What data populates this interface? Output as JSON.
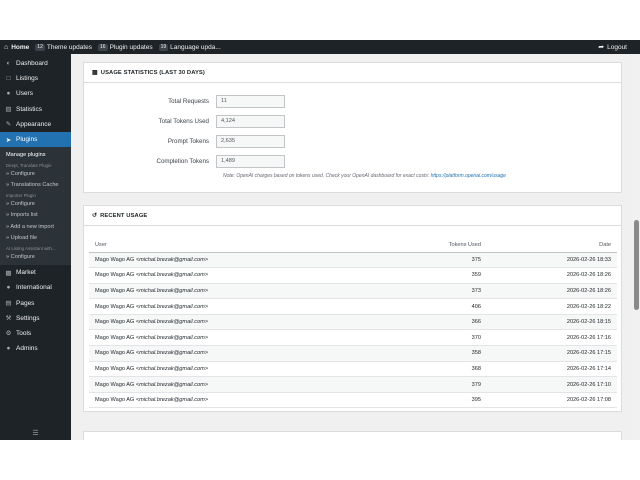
{
  "adminbar": {
    "home": "Home",
    "theme_count": "12",
    "theme_label": "Theme updates",
    "plugin_count": "16",
    "plugin_label": "Plugin updates",
    "lang_count": "19",
    "lang_label": "Language upda...",
    "logout": "Logout"
  },
  "sidebar": {
    "items_top": [
      {
        "icon": "dashboard-icon",
        "label": "Dashboard"
      },
      {
        "icon": "listings-icon",
        "label": "Listings"
      },
      {
        "icon": "users-icon",
        "label": "Users"
      },
      {
        "icon": "statistics-icon",
        "label": "Statistics"
      },
      {
        "icon": "appearance-icon",
        "label": "Appearance"
      }
    ],
    "active": "Plugins",
    "submenu": {
      "manage": "Manage plugins",
      "group1_head": "Deepl, Translate Plugin",
      "configure1": "» Configure",
      "translations_cache": "» Translations Cache",
      "group2_head": "Importer Plugin",
      "configure2": "» Configure",
      "imports_list": "» Imports list",
      "add_import": "» Add a new import",
      "upload_file": "» Upload file",
      "group3_head": "AI Listing Assistant with...",
      "configure3": "» Configure"
    },
    "items_bottom": [
      {
        "icon": "market-icon",
        "label": "Market"
      },
      {
        "icon": "globe-icon",
        "label": "International"
      },
      {
        "icon": "pages-icon",
        "label": "Pages"
      },
      {
        "icon": "wrench-icon",
        "label": "Settings"
      },
      {
        "icon": "gears-icon",
        "label": "Tools"
      },
      {
        "icon": "admins-icon",
        "label": "Admins"
      }
    ]
  },
  "stats": {
    "title": "USAGE STATISTICS (LAST 30 DAYS)",
    "total_requests_label": "Total Requests",
    "total_requests": "11",
    "total_tokens_label": "Total Tokens Used",
    "total_tokens": "4,124",
    "prompt_tokens_label": "Prompt Tokens",
    "prompt_tokens": "2,635",
    "completion_tokens_label": "Completion Tokens",
    "completion_tokens": "1,489",
    "note": "Note: OpenAI charges based on tokens used. Check your OpenAI dashboard for exact costs:",
    "note_link": "https://platform.openai.com/usage"
  },
  "recent": {
    "title": "RECENT USAGE",
    "col_user": "User",
    "col_tokens": "Tokens Used",
    "col_date": "Date",
    "rows": [
      {
        "user": "Mago Wago AG",
        "email": "<michal.brezak@gmail.com>",
        "tokens": "375",
        "date": "2026-02-26 18:33"
      },
      {
        "user": "Mago Wago AG",
        "email": "<michal.brezak@gmail.com>",
        "tokens": "359",
        "date": "2026-02-26 18:26"
      },
      {
        "user": "Mago Wago AG",
        "email": "<michal.brezak@gmail.com>",
        "tokens": "373",
        "date": "2026-02-26 18:26"
      },
      {
        "user": "Mago Wago AG",
        "email": "<michal.brezak@gmail.com>",
        "tokens": "406",
        "date": "2026-02-26 18:22"
      },
      {
        "user": "Mago Wago AG",
        "email": "<michal.brezak@gmail.com>",
        "tokens": "366",
        "date": "2026-02-26 18:15"
      },
      {
        "user": "Mago Wago AG",
        "email": "<michal.brezak@gmail.com>",
        "tokens": "370",
        "date": "2026-02-26 17:16"
      },
      {
        "user": "Mago Wago AG",
        "email": "<michal.brezak@gmail.com>",
        "tokens": "358",
        "date": "2026-02-26 17:15"
      },
      {
        "user": "Mago Wago AG",
        "email": "<michal.brezak@gmail.com>",
        "tokens": "368",
        "date": "2026-02-26 17:14"
      },
      {
        "user": "Mago Wago AG",
        "email": "<michal.brezak@gmail.com>",
        "tokens": "379",
        "date": "2026-02-26 17:10"
      },
      {
        "user": "Mago Wago AG",
        "email": "<michal.brezak@gmail.com>",
        "tokens": "395",
        "date": "2026-02-26 17:08"
      }
    ]
  },
  "colors": {
    "sidebar_bg": "#1d2327",
    "active_bg": "#2271b1",
    "content_bg": "#f0f0f1"
  }
}
